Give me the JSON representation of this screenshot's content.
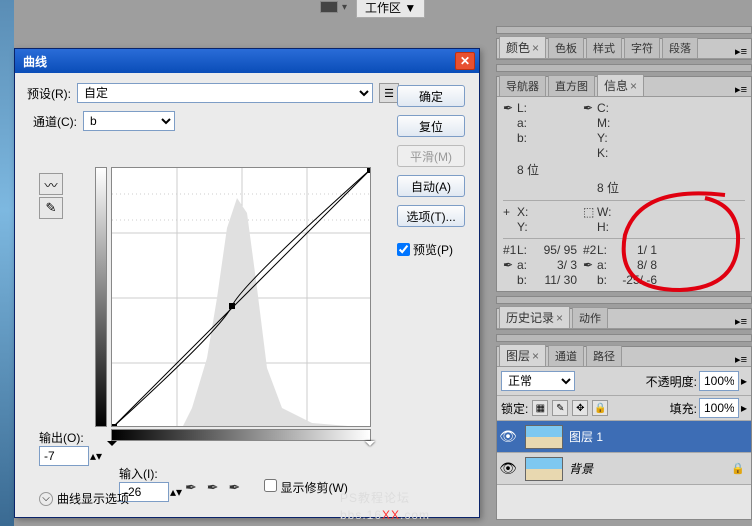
{
  "top": {
    "workspace": "工作区 ▼"
  },
  "dialog": {
    "title": "曲线",
    "preset_label": "预设(R):",
    "preset_value": "自定",
    "channel_label": "通道(C):",
    "channel_value": "b",
    "output_label": "输出(O):",
    "output_value": "-7",
    "input_label": "输入(I):",
    "input_value": "-26",
    "show_clip": "显示修剪(W)",
    "disclose": "曲线显示选项",
    "buttons": {
      "ok": "确定",
      "reset": "复位",
      "smooth": "平滑(M)",
      "auto": "自动(A)",
      "options": "选项(T)...",
      "preview": "预览(P)"
    }
  },
  "tabs": {
    "color": "颜色",
    "swatches": "色板",
    "styles": "样式",
    "char": "字符",
    "para": "段落",
    "navigator": "导航器",
    "histogram": "直方图",
    "info": "信息",
    "history": "历史记录",
    "actions": "动作",
    "layers": "图层",
    "channels": "通道",
    "paths": "路径"
  },
  "info": {
    "L": "L:",
    "Lv": "",
    "a": "a:",
    "av": "",
    "b": "b:",
    "bv": "",
    "C": "C:",
    "Cv": "",
    "M": "M:",
    "Mv": "",
    "Y": "Y:",
    "Yv": "",
    "K": "K:",
    "Kv": "",
    "bit": "8 位",
    "X": "X:",
    "Xv": "",
    "Yc": "Y:",
    "Ycv": "",
    "W": "W:",
    "Wv": "",
    "H": "H:",
    "Hv": "",
    "s1": "#1",
    "s2": "#2",
    "s1L": "95/  95",
    "s1a": "3/   3",
    "s1b": "11/  30",
    "s2L": "1/   1",
    "s2a": "8/   8",
    "s2b": "-25/  -6"
  },
  "layers": {
    "blend": "正常",
    "opacity_label": "不透明度:",
    "opacity_value": "100%",
    "lock_label": "锁定:",
    "fill_label": "填充:",
    "fill_value": "100%",
    "layer1": "图层 1",
    "bg": "背景"
  },
  "watermark": {
    "a": "PS教程论坛",
    "b": "bbs.16",
    "c": "XX",
    "d": ".com"
  }
}
